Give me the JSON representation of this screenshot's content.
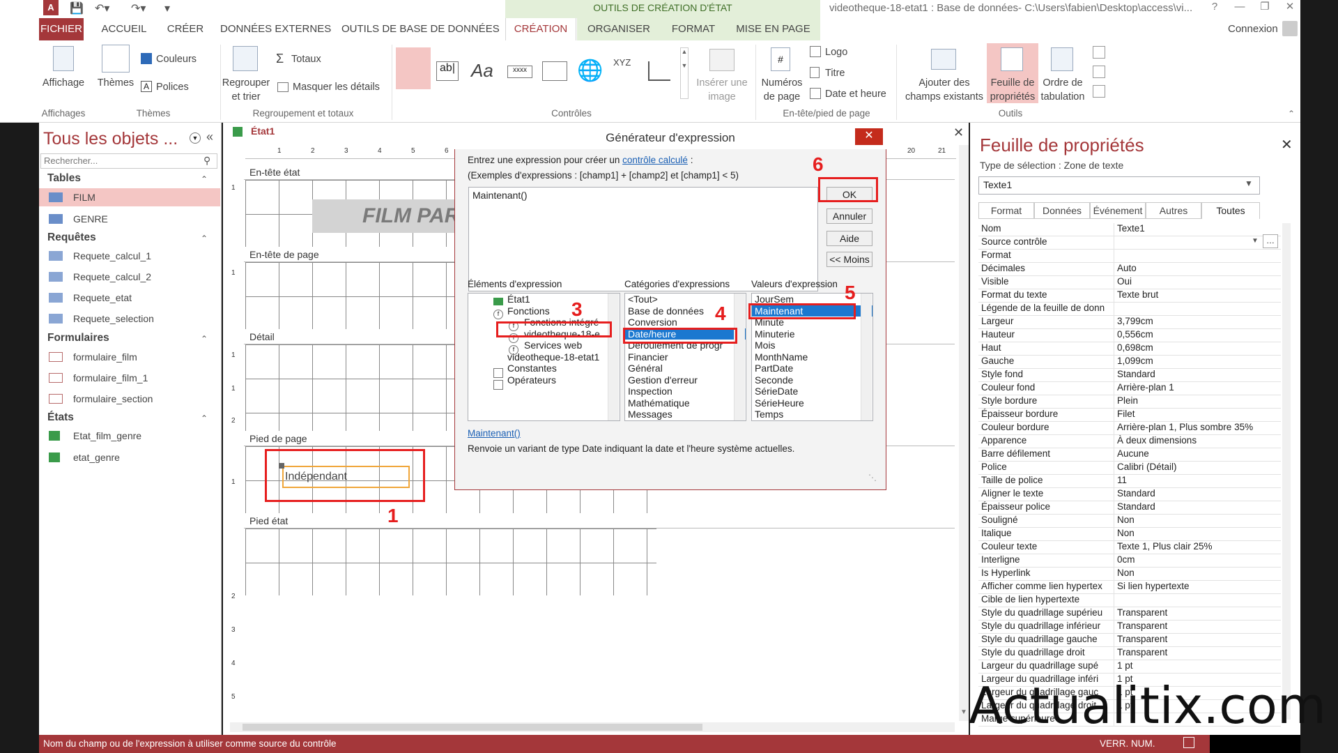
{
  "titlebar": {
    "context_title": "OUTILS DE CRÉATION D'ÉTAT",
    "doc_title": "videotheque-18-etat1 : Base de données- C:\\Users\\fabien\\Desktop\\access\\vi..."
  },
  "tabs": [
    "FICHIER",
    "ACCUEIL",
    "CRÉER",
    "DONNÉES EXTERNES",
    "OUTILS DE BASE DE DONNÉES",
    "CRÉATION",
    "ORGANISER",
    "FORMAT",
    "MISE EN PAGE"
  ],
  "connexion": "Connexion",
  "ribbon": {
    "affichage": "Affichage",
    "themes": "Thèmes",
    "couleurs": "Couleurs",
    "polices": "Polices",
    "regrouper": "Regrouper",
    "et_trier": "et trier",
    "totaux": "Totaux",
    "masquer": "Masquer les détails",
    "inserer": "Insérer une",
    "image": "image",
    "numeros": "Numéros",
    "de_page": "de page",
    "logo": "Logo",
    "titre": "Titre",
    "date_heure": "Date et heure",
    "ajouter": "Ajouter des",
    "champs": "champs existants",
    "feuille": "Feuille de",
    "proprietes": "propriétés",
    "ordre": "Ordre de",
    "tabulation": "tabulation",
    "groups": {
      "affichages": "Affichages",
      "themes": "Thèmes",
      "regroupement": "Regroupement et totaux",
      "controles": "Contrôles",
      "entete": "En-tête/pied de page",
      "outils": "Outils"
    }
  },
  "nav": {
    "title": "Tous les objets ...",
    "search_placeholder": "Rechercher...",
    "sections": [
      {
        "name": "Tables",
        "items": [
          "FILM",
          "GENRE"
        ]
      },
      {
        "name": "Requêtes",
        "items": [
          "Requete_calcul_1",
          "Requete_calcul_2",
          "Requete_etat",
          "Requete_selection"
        ]
      },
      {
        "name": "Formulaires",
        "items": [
          "formulaire_film",
          "formulaire_film_1",
          "formulaire_section"
        ]
      },
      {
        "name": "États",
        "items": [
          "Etat_film_genre",
          "etat_genre"
        ]
      }
    ]
  },
  "design": {
    "tab": "État1",
    "film_label": "FILM PAR",
    "sections": {
      "entete_etat": "En-tête état",
      "entete_page": "En-tête de page",
      "detail": "Détail",
      "pied_page": "Pied de page",
      "pied_etat": "Pied état"
    },
    "textbox": "Indépendant",
    "ruler_top": [
      "1",
      "2",
      "3",
      "4",
      "5",
      "6",
      "20",
      "21"
    ],
    "ruler_left": [
      "1",
      "1",
      "1",
      "1",
      "2",
      "1",
      "2",
      "3",
      "4",
      "5"
    ]
  },
  "dialog": {
    "title": "Générateur d'expression",
    "intro_prefix": "Entrez une expression pour créer un ",
    "intro_link": "contrôle calculé",
    "intro_suffix": " :",
    "examples": "(Exemples d'expressions : [champ1] + [champ2] et [champ1] < 5)",
    "expression": "Maintenant() ",
    "buttons": {
      "ok": "OK",
      "annuler": "Annuler",
      "aide": "Aide",
      "moins": "<< Moins"
    },
    "col_elements": "Éléments d'expression",
    "col_categories": "Catégories d'expressions",
    "col_values": "Valeurs d'expression",
    "elements": [
      "État1",
      "Fonctions",
      "Fonctions intégré",
      "videotheque-18-e",
      "Services web",
      "videotheque-18-etat1",
      "Constantes",
      "Opérateurs"
    ],
    "categories": [
      "<Tout>",
      "Base de données",
      "Conversion",
      "Date/heure",
      "Déroulement de progr",
      "Financier",
      "Général",
      "Gestion d'erreur",
      "Inspection",
      "Mathématique",
      "Messages"
    ],
    "values": [
      "JourSem",
      "Maintenant",
      "Minute",
      "Minuterie",
      "Mois",
      "MonthName",
      "PartDate",
      "Seconde",
      "SérieDate",
      "SérieHeure",
      "Temps"
    ],
    "func_link": "Maintenant()",
    "func_desc": "Renvoie un variant de type Date indiquant la date et l'heure système actuelles."
  },
  "annotations": [
    "1",
    "2",
    "3",
    "4",
    "5",
    "6"
  ],
  "props": {
    "title": "Feuille de propriétés",
    "sel_type": "Type de sélection : Zone de texte",
    "sel_value": "Texte1",
    "tabs": [
      "Format",
      "Données",
      "Événement",
      "Autres",
      "Toutes"
    ],
    "rows": [
      [
        "Nom",
        "Texte1"
      ],
      [
        "Source contrôle",
        ""
      ],
      [
        "Format",
        ""
      ],
      [
        "Décimales",
        "Auto"
      ],
      [
        "Visible",
        "Oui"
      ],
      [
        "Format du texte",
        "Texte brut"
      ],
      [
        "Légende de la feuille de donn",
        ""
      ],
      [
        "Largeur",
        "3,799cm"
      ],
      [
        "Hauteur",
        "0,556cm"
      ],
      [
        "Haut",
        "0,698cm"
      ],
      [
        "Gauche",
        "1,099cm"
      ],
      [
        "Style fond",
        "Standard"
      ],
      [
        "Couleur fond",
        "Arrière-plan 1"
      ],
      [
        "Style bordure",
        "Plein"
      ],
      [
        "Épaisseur bordure",
        "Filet"
      ],
      [
        "Couleur bordure",
        "Arrière-plan 1, Plus sombre 35%"
      ],
      [
        "Apparence",
        "À deux dimensions"
      ],
      [
        "Barre défilement",
        "Aucune"
      ],
      [
        "Police",
        "Calibri (Détail)"
      ],
      [
        "Taille de police",
        "11"
      ],
      [
        "Aligner le texte",
        "Standard"
      ],
      [
        "Épaisseur police",
        "Standard"
      ],
      [
        "Souligné",
        "Non"
      ],
      [
        "Italique",
        "Non"
      ],
      [
        "Couleur texte",
        "Texte 1, Plus clair 25%"
      ],
      [
        "Interligne",
        "0cm"
      ],
      [
        "Is Hyperlink",
        "Non"
      ],
      [
        "Afficher comme lien hypertex",
        "Si lien hypertexte"
      ],
      [
        "Cible de lien hypertexte",
        ""
      ],
      [
        "Style du quadrillage supérieu",
        "Transparent"
      ],
      [
        "Style du quadrillage inférieur",
        "Transparent"
      ],
      [
        "Style du quadrillage gauche",
        "Transparent"
      ],
      [
        "Style du quadrillage droit",
        "Transparent"
      ],
      [
        "Largeur du quadrillage supé",
        "1 pt"
      ],
      [
        "Largeur du quadrillage inféri",
        "1 pt"
      ],
      [
        "Largeur du quadrillage gauc",
        "1 pt"
      ],
      [
        "Largeur du quadrillage droit",
        "1 pt"
      ],
      [
        "Marge supérieure",
        ""
      ]
    ]
  },
  "status": {
    "left": "Nom du champ ou de l'expression à utiliser comme source du contrôle",
    "right": "VERR. NUM."
  },
  "watermark": "Actualitix.com"
}
